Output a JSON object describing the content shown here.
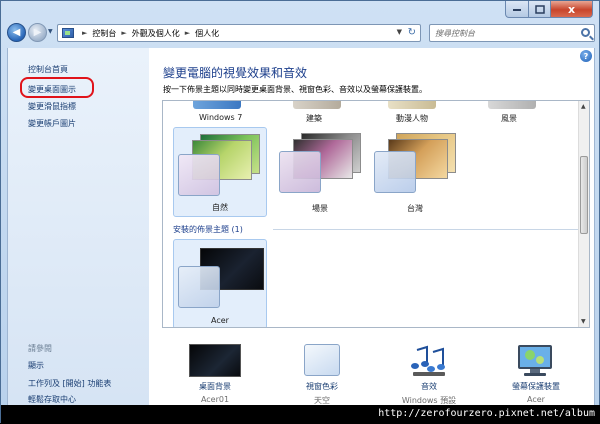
{
  "window": {
    "close_glyph": "x"
  },
  "nav": {
    "address": {
      "crumbs": [
        "控制台",
        "外觀及個人化",
        "個人化"
      ]
    },
    "search": {
      "placeholder": "搜尋控制台"
    }
  },
  "sidebar": {
    "items": [
      {
        "label": "控制台首頁"
      },
      {
        "label": "變更桌面圖示",
        "highlighted": true
      },
      {
        "label": "變更滑鼠指標"
      },
      {
        "label": "變更帳戶圖片"
      }
    ],
    "see_also": {
      "title": "請參閱",
      "links": [
        {
          "label": "顯示"
        },
        {
          "label": "工作列及 [開始] 功能表"
        },
        {
          "label": "輕鬆存取中心"
        }
      ]
    }
  },
  "main": {
    "title": "變更電腦的視覺效果和音效",
    "description": "按一下佈景主題以同時變更桌面背景、視窗色彩、音效以及螢幕保護裝置。",
    "top_row": [
      {
        "label": "Windows 7"
      },
      {
        "label": "建築"
      },
      {
        "label": "動漫人物"
      },
      {
        "label": "風景"
      }
    ],
    "themes": [
      {
        "label": "自然",
        "selected": true
      },
      {
        "label": "場景",
        "selected": false
      },
      {
        "label": "台灣",
        "selected": false
      }
    ],
    "installed": {
      "title": "安裝的佈景主題 (1)",
      "themes": [
        {
          "label": "Acer",
          "selected": true
        }
      ]
    },
    "help_glyph": "?"
  },
  "bottom": [
    {
      "label": "桌面背景",
      "sub": "Acer01"
    },
    {
      "label": "視窗色彩",
      "sub": "天空"
    },
    {
      "label": "音效",
      "sub": "Windows 預設"
    },
    {
      "label": "螢幕保護裝置",
      "sub": "Acer"
    }
  ],
  "watermark": "http://zerofourzero.pixnet.net/album",
  "colors": {
    "highlight_circle": "#e0131a",
    "link": "#1b3f73",
    "title": "#1d3f8c"
  }
}
